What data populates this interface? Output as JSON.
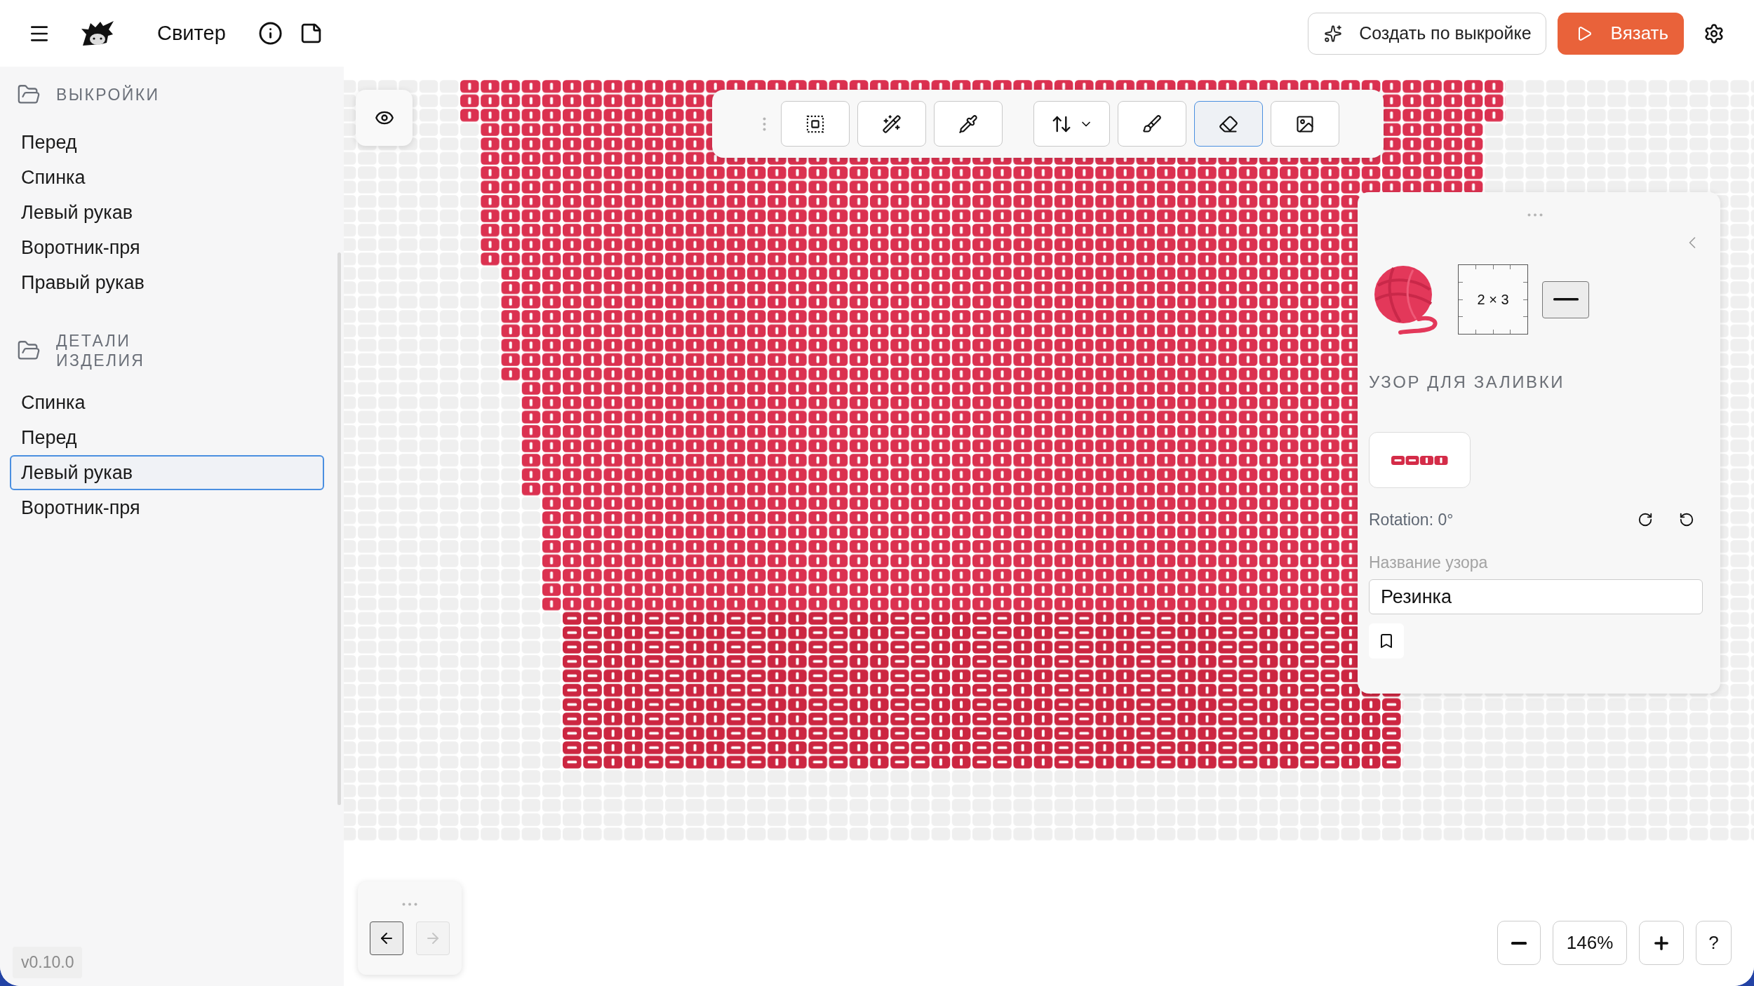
{
  "header": {
    "title": "Свитер",
    "create_button": "Создать по выкройке",
    "knit_button": "Вязать"
  },
  "sidebar": {
    "sections": [
      {
        "title": "ВЫКРОЙКИ",
        "items": [
          {
            "label": "Перед",
            "selected": false
          },
          {
            "label": "Спинка",
            "selected": false
          },
          {
            "label": "Левый рукав",
            "selected": false
          },
          {
            "label": "Воротник-пря",
            "selected": false
          },
          {
            "label": "Правый рукав",
            "selected": false
          }
        ]
      },
      {
        "title": "ДЕТАЛИ ИЗДЕЛИЯ",
        "items": [
          {
            "label": "Спинка",
            "selected": false
          },
          {
            "label": "Перед",
            "selected": false
          },
          {
            "label": "Левый рукав",
            "selected": true
          },
          {
            "label": "Воротник-пря",
            "selected": false
          }
        ]
      }
    ],
    "version": "v0.10.0"
  },
  "toolbar": {
    "groups": [
      {
        "tools": [
          {
            "kind": "button",
            "selected": false
          },
          {
            "kind": "button",
            "selected": false
          },
          {
            "kind": "button",
            "selected": false
          }
        ]
      },
      {
        "tools": [
          {
            "kind": "dropdown",
            "selected": false
          },
          {
            "kind": "button",
            "selected": false
          },
          {
            "kind": "button",
            "selected": true
          },
          {
            "kind": "button",
            "selected": false
          }
        ]
      }
    ]
  },
  "fill_panel": {
    "size": "2 × 3",
    "heading": "УЗОР ДЛЯ ЗАЛИВКИ",
    "pattern": [
      {
        "kind": "purl"
      },
      {
        "kind": "purl"
      },
      {
        "kind": "knit"
      },
      {
        "kind": "knit"
      }
    ],
    "rotation": "Rotation: 0°",
    "name_label": "Название узора",
    "name_value": "Резинка"
  },
  "history": {
    "back": {
      "disabled": false
    },
    "forward": {
      "disabled": true
    }
  },
  "zoom": {
    "value": "146%",
    "help": "?"
  }
}
